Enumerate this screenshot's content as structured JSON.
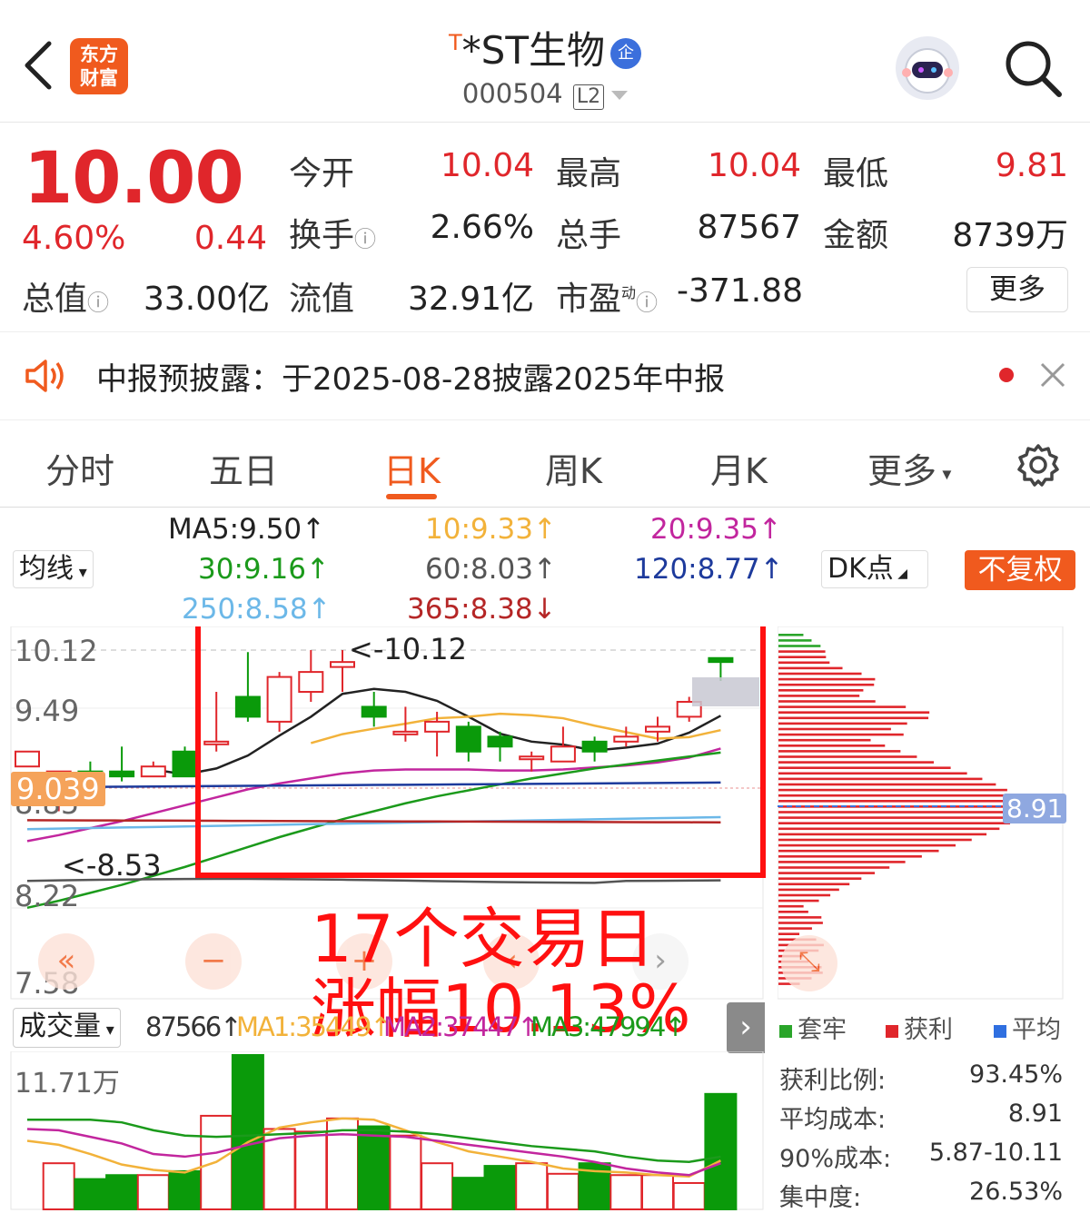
{
  "header": {
    "title": "*ST生物",
    "title_prefix": "T",
    "badge": "企",
    "code": "000504",
    "level": "L2",
    "app_logo": "东方财富"
  },
  "quote": {
    "price": "10.00",
    "pct": "4.60%",
    "chg": "0.44",
    "fields": [
      {
        "label": "今开",
        "value": "10.04",
        "color": "red"
      },
      {
        "label": "最高",
        "value": "10.04",
        "color": "red"
      },
      {
        "label": "最低",
        "value": "9.81",
        "color": "red"
      },
      {
        "label": "换手",
        "value": "2.66%"
      },
      {
        "label": "总手",
        "value": "87567"
      },
      {
        "label": "金额",
        "value": "8739万"
      },
      {
        "label": "总值",
        "value": "33.00亿"
      },
      {
        "label": "流值",
        "value": "32.91亿"
      },
      {
        "label": "市盈",
        "value": "-371.88",
        "sup": "动"
      }
    ],
    "more": "更多"
  },
  "notice": {
    "text": "中报预披露：于2025-08-28披露2025年中报"
  },
  "tabs": [
    "分时",
    "五日",
    "日K",
    "周K",
    "月K",
    "更多"
  ],
  "active_tab": "日K",
  "ma_bar": {
    "ma5": "MA5:9.50↑",
    "ma10": "10:9.33↑",
    "ma20": "20:9.35↑",
    "ma30": "30:9.16↑",
    "ma60": "60:8.03↑",
    "ma120": "120:8.77↑",
    "ma250": "250:8.58↑",
    "ma365": "365:8.38↓",
    "junxian": "均线",
    "dk": "DK点",
    "fuquan": "不复权"
  },
  "chart_labels": {
    "y_ticks": [
      "10.12",
      "9.49",
      "8.85",
      "8.22",
      "7.58"
    ],
    "high_mark": "<-10.12",
    "low_mark": "<-8.53",
    "cursor_price": "9.039",
    "avg_cost": "8.91"
  },
  "annotation": {
    "line1": "17个交易日",
    "line2": "涨幅10.13%"
  },
  "volume": {
    "label": "成交量",
    "vol": "87566↑",
    "ma1": "MA1:35449↑",
    "ma2": "MA2:37447↑",
    "ma3": "MA3:47994↑",
    "ymax": "11.71万"
  },
  "legend": {
    "trapped": "套牢",
    "profit": "获利",
    "avg": "平均"
  },
  "chips": {
    "rows": [
      {
        "label": "获利比例:",
        "value": "93.45%"
      },
      {
        "label": "平均成本:",
        "value": "8.91"
      },
      {
        "label": "90%成本:",
        "value": "5.87-10.11"
      },
      {
        "label": "集中度:",
        "value": "26.53%"
      }
    ]
  },
  "chart_data": {
    "type": "candlestick",
    "ohlc": [
      [
        8.95,
        9.1,
        8.75,
        8.6
      ],
      [
        8.85,
        8.9,
        8.6,
        8.5
      ],
      [
        8.9,
        8.8,
        9.0,
        8.75
      ],
      [
        8.9,
        8.85,
        9.15,
        8.8
      ],
      [
        8.85,
        8.95,
        9.0,
        8.9
      ],
      [
        9.1,
        8.85,
        9.15,
        8.85
      ],
      [
        9.2,
        9.2,
        9.7,
        9.1
      ],
      [
        9.65,
        9.45,
        10.1,
        9.4
      ],
      [
        9.4,
        9.85,
        9.9,
        9.3
      ],
      [
        9.7,
        9.9,
        10.12,
        9.6
      ],
      [
        9.95,
        10.0,
        10.12,
        9.7
      ],
      [
        9.55,
        9.45,
        9.7,
        9.35
      ],
      [
        9.3,
        9.3,
        9.55,
        9.2
      ],
      [
        9.3,
        9.4,
        9.5,
        9.05
      ],
      [
        9.35,
        9.1,
        9.4,
        9.0
      ],
      [
        9.25,
        9.15,
        9.3,
        9.0
      ],
      [
        9.05,
        9.05,
        9.1,
        8.9
      ],
      [
        9.0,
        9.15,
        9.35,
        9.0
      ],
      [
        9.2,
        9.1,
        9.25,
        9.0
      ],
      [
        9.2,
        9.25,
        9.35,
        9.15
      ],
      [
        9.3,
        9.35,
        9.45,
        9.2
      ],
      [
        9.45,
        9.6,
        9.65,
        9.4
      ],
      [
        10.04,
        10.0,
        10.04,
        9.81
      ]
    ],
    "volumes": [
      null,
      3.5,
      2.3,
      2.6,
      2.6,
      2.9,
      7.1,
      11.71,
      6.1,
      5.9,
      6.9,
      6.3,
      5.6,
      3.5,
      2.4,
      3.3,
      3.5,
      2.7,
      3.5,
      2.6,
      2.6,
      2.0,
      8.76
    ],
    "volume_unit": "万"
  }
}
